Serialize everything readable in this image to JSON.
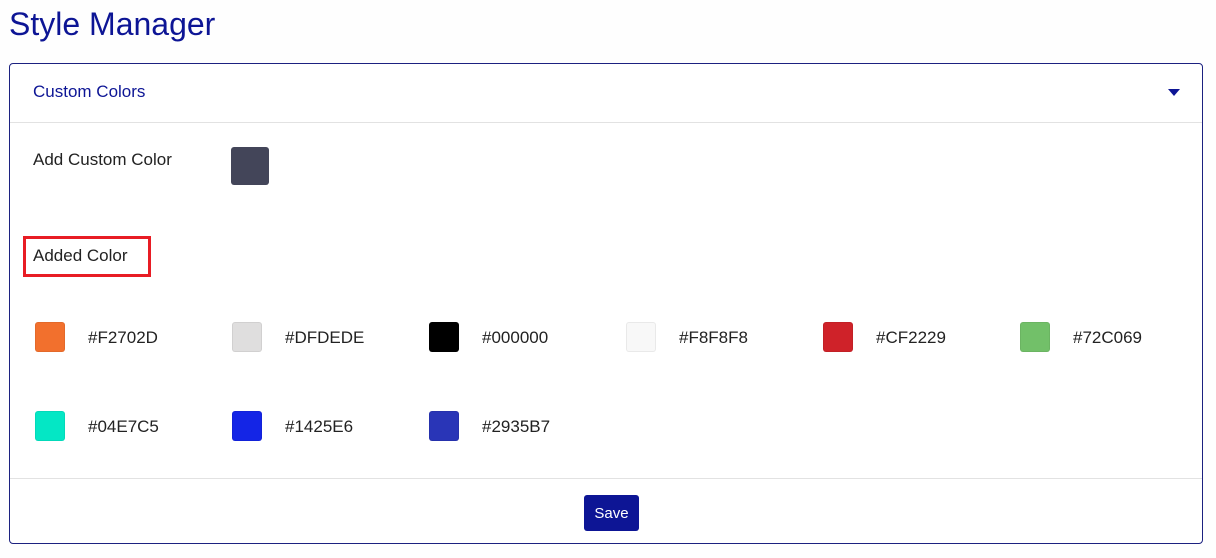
{
  "page": {
    "title": "Style Manager"
  },
  "panel": {
    "header_title": "Custom Colors",
    "add_custom_label": "Add Custom Color",
    "custom_color": "#434559",
    "added_label": "Added Color",
    "save_label": "Save"
  },
  "colors": [
    {
      "hex": "#F2702D"
    },
    {
      "hex": "#DFDEDE"
    },
    {
      "hex": "#000000"
    },
    {
      "hex": "#F8F8F8"
    },
    {
      "hex": "#CF2229"
    },
    {
      "hex": "#72C069"
    },
    {
      "hex": "#04E7C5"
    },
    {
      "hex": "#1425E6"
    },
    {
      "hex": "#2935B7"
    }
  ],
  "theme": {
    "accent": "#0D1595",
    "highlight": "#E81C24"
  }
}
